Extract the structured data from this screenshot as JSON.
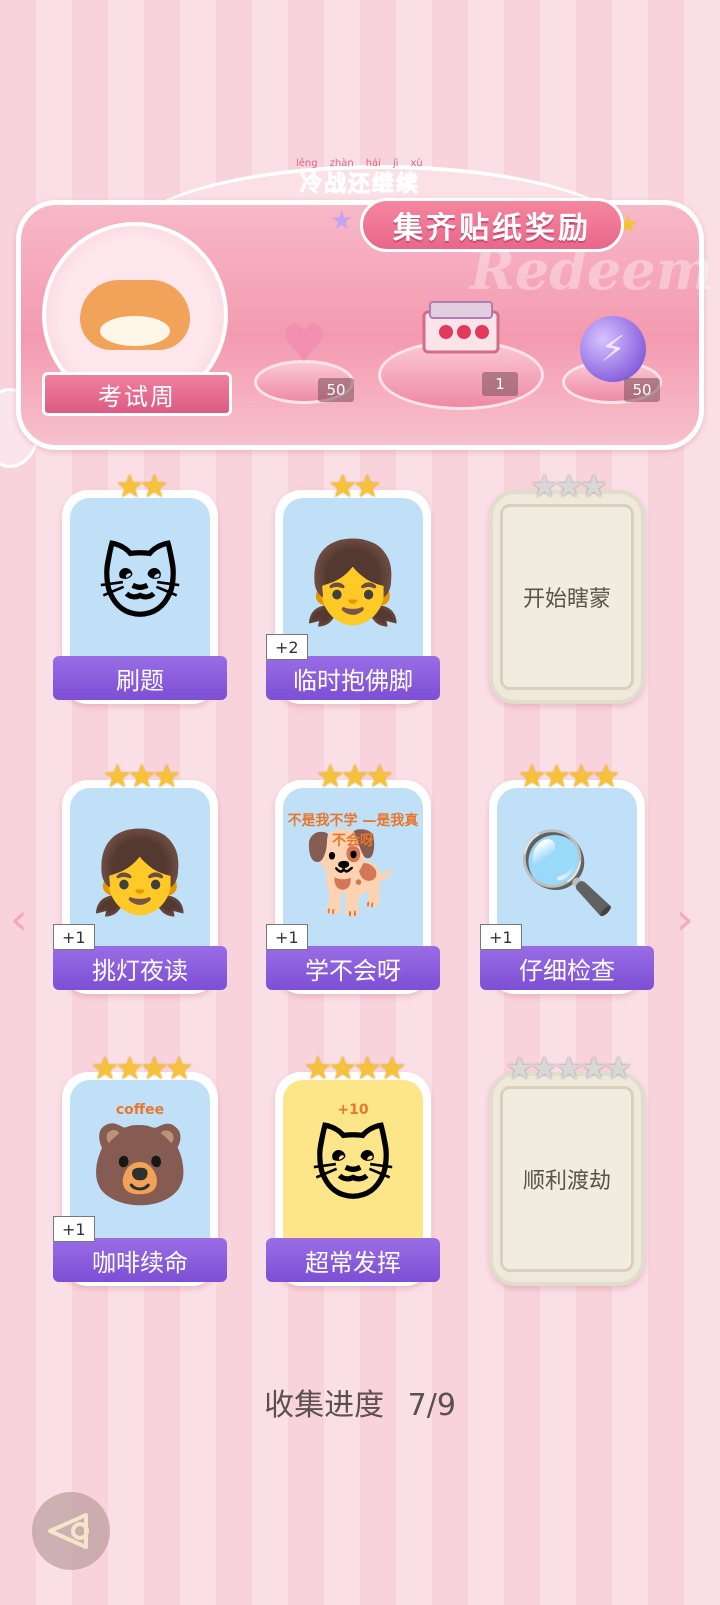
{
  "header": {
    "pinyin": [
      "lěng",
      "zhàn",
      "hái",
      "jì",
      "xù"
    ],
    "subtitle": "冷战还继续",
    "title": "集齐贴纸奖励",
    "watermark": "Redeem",
    "theme_tag": "考试周"
  },
  "rewards": [
    {
      "icon": "heart-gem-icon",
      "count": "50"
    },
    {
      "icon": "gift-box-icon",
      "count": "1"
    },
    {
      "icon": "lightning-orb-icon",
      "count": "50"
    }
  ],
  "cards": [
    {
      "label": "刷题",
      "stars": 2,
      "collected": true,
      "bonus": "",
      "emoji": "🐱",
      "bg": "#bfe0f7"
    },
    {
      "label": "临时抱佛脚",
      "stars": 2,
      "collected": true,
      "bonus": "+2",
      "emoji": "👧",
      "bg": "#bfe0f7"
    },
    {
      "label": "开始瞎蒙",
      "stars": 3,
      "collected": false,
      "bonus": "",
      "emoji": "",
      "bg": ""
    },
    {
      "label": "挑灯夜读",
      "stars": 3,
      "collected": true,
      "bonus": "+1",
      "emoji": "👧",
      "bg": "#bfe0f7"
    },
    {
      "label": "学不会呀",
      "stars": 3,
      "collected": true,
      "bonus": "+1",
      "emoji": "🐕",
      "bg": "#bfe0f7",
      "caption": "不是我不学 —是我真不会呀"
    },
    {
      "label": "仔细检查",
      "stars": 4,
      "collected": true,
      "bonus": "+1",
      "emoji": "🔍",
      "bg": "#bfe0f7"
    },
    {
      "label": "咖啡续命",
      "stars": 4,
      "collected": true,
      "bonus": "+1",
      "emoji": "🐻",
      "bg": "#bfe0f7",
      "caption": "coffee"
    },
    {
      "label": "超常发挥",
      "stars": 4,
      "collected": true,
      "bonus": "",
      "emoji": "🐱",
      "bg": "#fde58a",
      "caption": "+10"
    },
    {
      "label": "顺利渡劫",
      "stars": 5,
      "collected": false,
      "bonus": "",
      "emoji": "",
      "bg": ""
    }
  ],
  "progress": {
    "label": "收集进度",
    "value": "7/9"
  },
  "nav": {
    "prev": "‹",
    "next": "›",
    "back_icon": "back-icon"
  },
  "colors": {
    "label_purple": "#8a5ddf",
    "star_gold": "#f6c338",
    "star_silver": "#d8d8d8",
    "banner_pink": "#f49ab0"
  }
}
